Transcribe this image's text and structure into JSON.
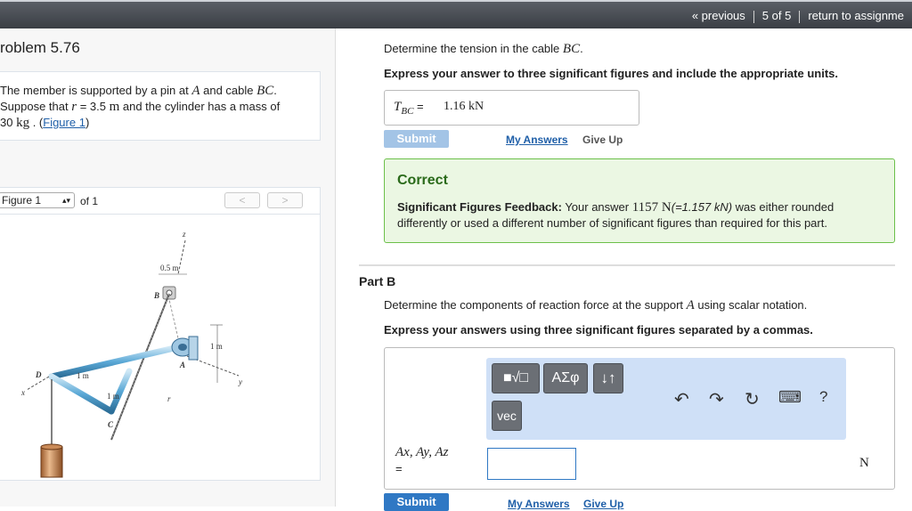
{
  "nav": {
    "previous": "« previous",
    "position": "5 of 5",
    "return": "return to assignme"
  },
  "left": {
    "title": "roblem 5.76",
    "problem": {
      "t1": "The member is supported by a pin at ",
      "A": "A",
      "t2": " and cable ",
      "BC": "BC",
      "t3": ".",
      "t4": "Suppose that ",
      "r": "r",
      "t5": " = 3.5 ",
      "m": "m",
      "t6": " and the cylinder has a mass of",
      "t7": "30 ",
      "kg": "kg",
      "t8": " . (",
      "fig_link": "Figure 1",
      "t9": ")"
    },
    "figure_bar": {
      "select": "Figure 1",
      "of": "of 1",
      "prev": "<",
      "next": ">"
    },
    "figure_labels": {
      "z": "z",
      "dim05": "0.5 m",
      "B": "B",
      "A": "A",
      "D": "D",
      "dim1a": "1 m",
      "dim1b": "1 m",
      "dim1c": "1 m",
      "C": "C",
      "r": "r",
      "x": "x",
      "y": "y"
    }
  },
  "partA": {
    "question": "Determine the tension in the cable ",
    "BC": "BC",
    "q_end": ".",
    "instruction": "Express your answer to three significant figures and include the appropriate units.",
    "answer_label": "T",
    "answer_sub": "BC",
    "answer_eq": " = ",
    "answer_value": "1.16 kN",
    "submit": "Submit",
    "my_answers": "My Answers",
    "give_up": "Give Up",
    "feedback": {
      "title": "Correct",
      "label": "Significant Figures Feedback:",
      "t1": " Your answer ",
      "value": "1157 N",
      "t2": "(=1.157 kN)",
      "t3": " was either rounded",
      "line2": "differently or used a different number of significant figures than required for this part."
    }
  },
  "partB": {
    "title": "Part B",
    "question": "Determine the components of reaction force at the support ",
    "A": "A",
    "q_end": " using scalar notation.",
    "instruction": "Express your answers using three significant figures separated by a commas.",
    "toolbar": {
      "templates": "■√□",
      "greek": "ΑΣφ",
      "sort": "↓↑",
      "vec": "vec",
      "undo": "↶",
      "redo": "↷",
      "reset": "↻",
      "keyboard": "⌨",
      "help": "?"
    },
    "answer_label": "Ax, Ay, Az",
    "answer_eq": "=",
    "unit": "N",
    "submit": "Submit",
    "my_answers": "My Answers",
    "give_up": "Give Up"
  }
}
